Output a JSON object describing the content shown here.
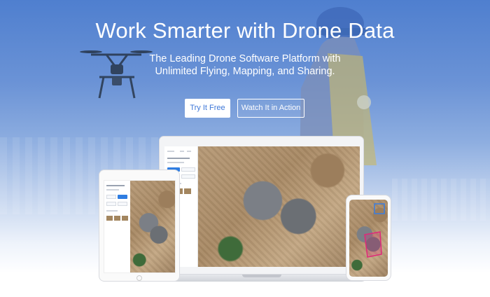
{
  "hero": {
    "headline": "Work Smarter with Drone Data",
    "subline_1": "The Leading Drone Software Platform with",
    "subline_2": "Unlimited Flying, Mapping, and Sharing.",
    "primary_cta": "Try It Free",
    "secondary_cta": "Watch It in Action"
  },
  "colors": {
    "accent": "#3f78d8",
    "hero_top": "#4f7fcf",
    "button_text_white": "#ffffff"
  },
  "devices": [
    "laptop",
    "tablet",
    "phone"
  ]
}
